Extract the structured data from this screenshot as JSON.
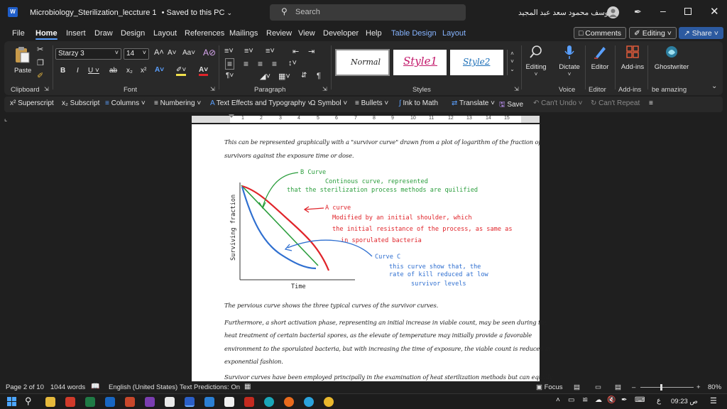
{
  "titlebar": {
    "app_badge": "W",
    "doc_title": "Microbiology_Sterilization_leccture 1",
    "saved_status": "• Saved to this PC",
    "search_placeholder": "Search",
    "user_name": "يوسف محمود سعد عبد المجيد"
  },
  "menu": {
    "tabs": [
      "File",
      "Home",
      "Insert",
      "Draw",
      "Design",
      "Layout",
      "References",
      "Mailings",
      "Review",
      "View",
      "Developer",
      "Help",
      "Table Design",
      "Layout"
    ],
    "active_tab": "Home",
    "comments_label": "Comments",
    "editing_label": "Editing",
    "share_label": "Share"
  },
  "ribbon": {
    "paste_label": "Paste",
    "font_name": "Starzy 3",
    "font_size": "14",
    "styles": [
      "Normal",
      "Style1",
      "Style2"
    ],
    "editing_btn": "Editing",
    "dictate_btn": "Dictate",
    "editor_btn": "Editor",
    "addins_btn": "Add-ins",
    "ghostwriter_btn": "Ghostwriter",
    "groups": {
      "clipboard": "Clipboard",
      "font": "Font",
      "paragraph": "Paragraph",
      "styles": "Styles",
      "voice": "Voice",
      "editor": "Editor",
      "addins": "Add-ins",
      "be_amazing": "be amazing"
    }
  },
  "qat": {
    "superscript": "Superscript",
    "subscript": "Subscript",
    "columns": "Columns",
    "numbering": "Numbering",
    "text_effects": "Text Effects and Typography",
    "symbol": "Symbol",
    "bullets": "Bullets",
    "ink_to_math": "Ink to Math",
    "translate": "Translate",
    "save": "Save",
    "cant_undo": "Can't Undo",
    "cant_repeat": "Can't Repeat"
  },
  "ruler": {
    "ticks": [
      "1",
      "2",
      "3",
      "4",
      "5",
      "6",
      "7",
      "8",
      "9",
      "10",
      "11",
      "12",
      "13",
      "14",
      "15"
    ]
  },
  "document": {
    "para1_line1": "This can be represented graphically with a \"survivor curve\" drawn from a plot of logarithm of the fraction of",
    "para1_line2": "survivors against the exposure time or dose.",
    "para2": "The pervious curve shows the three typical curves of the survivor curves.",
    "para3_line1": "Furthermore, a short activation phase, representing an initial increase in viable count, may be seen during the",
    "para3_line2": "heat treatment of certain bacterial spores, as the elevate of temperature may initially provide a favorable",
    "para3_line3": "environment to the sporulated bacteria, but with increasing the time of exposure, the viable count is reduced in",
    "para3_line4": "exponential fashion.",
    "para4_line1": "Survivor curves have been employed principally in the examination of heat sterilization methods but can equally"
  },
  "chart": {
    "ylabel": "Surviving fraction",
    "xlabel": "Time",
    "b_title": "B Curve",
    "b_note1": "Continous curve, represented",
    "b_note2": "that the sterilization process methods are quilified",
    "a_title": "A curve",
    "a_note1": "Modified by an initial shoulder, which",
    "a_note2": "the initial resistance of the process, as same as",
    "a_note3": "in sporulated bacteria",
    "c_title": "Curve C",
    "c_note1": "this curve show that, the",
    "c_note2": "rate of kill reduced at low",
    "c_note3": "survivor levels",
    "colors": {
      "a": "#e0242a",
      "b": "#2a9d3c",
      "c": "#2f6fd0"
    }
  },
  "status": {
    "page": "Page 2 of 10",
    "words": "1044 words",
    "language": "English (United States)",
    "predictions": "Text Predictions: On",
    "focus": "Focus",
    "zoom": "80%"
  },
  "taskbar": {
    "lang": "ع",
    "time": "09:23 ص"
  }
}
